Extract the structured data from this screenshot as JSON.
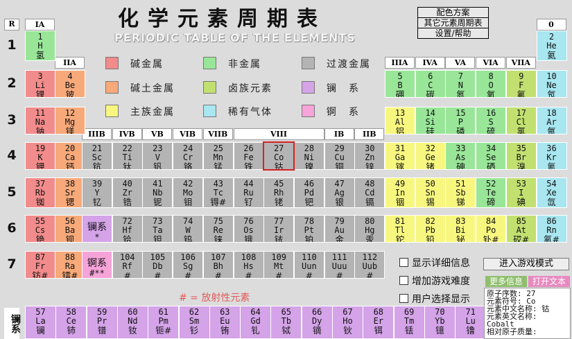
{
  "window": {
    "title": "化学元素周期表",
    "subtitle": "PERIODIC TABLE OF THE ELEMENTS"
  },
  "menu": [
    {
      "label": "配色方案"
    },
    {
      "label": "其它元素周期表"
    },
    {
      "label": "设置/帮助"
    }
  ],
  "period_header": "R",
  "periods": [
    "1",
    "2",
    "3",
    "4",
    "5",
    "6",
    "7"
  ],
  "groups": [
    {
      "label": "IA",
      "pos": "ia"
    },
    {
      "label": "IIA",
      "pos": "iia"
    },
    {
      "label": "IIIB",
      "pos": "3"
    },
    {
      "label": "IVB",
      "pos": "4"
    },
    {
      "label": "VB",
      "pos": "5"
    },
    {
      "label": "VIB",
      "pos": "6"
    },
    {
      "label": "VIIB",
      "pos": "7"
    },
    {
      "label": "VIII",
      "pos": "8"
    },
    {
      "label": "IB",
      "pos": "11"
    },
    {
      "label": "IIB",
      "pos": "12"
    },
    {
      "label": "IIIA",
      "pos": "13"
    },
    {
      "label": "IVA",
      "pos": "14"
    },
    {
      "label": "VA",
      "pos": "15"
    },
    {
      "label": "VIA",
      "pos": "16"
    },
    {
      "label": "VIIA",
      "pos": "17"
    },
    {
      "label": "0",
      "pos": "0"
    }
  ],
  "colors": {
    "alkali": "#f28b8b",
    "alkaline": "#f7a97a",
    "nonmetal": "#99e699",
    "halogen": "#c2e070",
    "transition": "#b4b4b4",
    "lanthanide": "#d4a3e8",
    "main_metal": "#f7f780",
    "noble": "#a8e6f0",
    "actinide": "#f5a3d8",
    "selected": "#d62020",
    "radioactive_note": "#e45a5a",
    "tab_more": "#8fbf6e",
    "tab_open": "#e889c0"
  },
  "legend": [
    {
      "label": "碱金属",
      "color": "alkali"
    },
    {
      "label": "碱土金属",
      "color": "alkaline"
    },
    {
      "label": "主族金属",
      "color": "main_metal"
    },
    {
      "label": "非金属",
      "color": "nonmetal"
    },
    {
      "label": "卤族元素",
      "color": "halogen"
    },
    {
      "label": "稀有气体",
      "color": "noble"
    },
    {
      "label": "过渡金属",
      "color": "transition"
    },
    {
      "label": "镧　系",
      "color": "lanthanide"
    },
    {
      "label": "锕　系",
      "color": "actinide"
    }
  ],
  "elements": [
    {
      "z": "1",
      "sym": "H",
      "name": "氢",
      "cat": "nonmetal",
      "col": 1,
      "row": 1
    },
    {
      "z": "2",
      "sym": "He",
      "name": "氦",
      "cat": "noble",
      "col": 18,
      "row": 1
    },
    {
      "z": "3",
      "sym": "Li",
      "name": "锂",
      "cat": "alkali",
      "col": 1,
      "row": 2
    },
    {
      "z": "4",
      "sym": "Be",
      "name": "铍",
      "cat": "alkaline",
      "col": 2,
      "row": 2
    },
    {
      "z": "5",
      "sym": "B",
      "name": "硼",
      "cat": "nonmetal",
      "col": 13,
      "row": 2
    },
    {
      "z": "6",
      "sym": "C",
      "name": "碳",
      "cat": "nonmetal",
      "col": 14,
      "row": 2
    },
    {
      "z": "7",
      "sym": "N",
      "name": "氮",
      "cat": "nonmetal",
      "col": 15,
      "row": 2
    },
    {
      "z": "8",
      "sym": "O",
      "name": "氧",
      "cat": "nonmetal",
      "col": 16,
      "row": 2
    },
    {
      "z": "9",
      "sym": "F",
      "name": "氟",
      "cat": "halogen",
      "col": 17,
      "row": 2
    },
    {
      "z": "10",
      "sym": "Ne",
      "name": "氖",
      "cat": "noble",
      "col": 18,
      "row": 2
    },
    {
      "z": "11",
      "sym": "Na",
      "name": "钠",
      "cat": "alkali",
      "col": 1,
      "row": 3
    },
    {
      "z": "12",
      "sym": "Mg",
      "name": "镁",
      "cat": "alkaline",
      "col": 2,
      "row": 3
    },
    {
      "z": "13",
      "sym": "Al",
      "name": "铝",
      "cat": "main_metal",
      "col": 13,
      "row": 3
    },
    {
      "z": "14",
      "sym": "Si",
      "name": "硅",
      "cat": "nonmetal",
      "col": 14,
      "row": 3
    },
    {
      "z": "15",
      "sym": "P",
      "name": "磷",
      "cat": "nonmetal",
      "col": 15,
      "row": 3
    },
    {
      "z": "16",
      "sym": "S",
      "name": "硫",
      "cat": "nonmetal",
      "col": 16,
      "row": 3
    },
    {
      "z": "17",
      "sym": "Cl",
      "name": "氯",
      "cat": "halogen",
      "col": 17,
      "row": 3
    },
    {
      "z": "18",
      "sym": "Ar",
      "name": "氩",
      "cat": "noble",
      "col": 18,
      "row": 3
    },
    {
      "z": "19",
      "sym": "K",
      "name": "钾",
      "cat": "alkali",
      "col": 1,
      "row": 4
    },
    {
      "z": "20",
      "sym": "Ca",
      "name": "钙",
      "cat": "alkaline",
      "col": 2,
      "row": 4
    },
    {
      "z": "21",
      "sym": "Sc",
      "name": "钪",
      "cat": "transition",
      "col": 3,
      "row": 4
    },
    {
      "z": "22",
      "sym": "Ti",
      "name": "钛",
      "cat": "transition",
      "col": 4,
      "row": 4
    },
    {
      "z": "23",
      "sym": "V",
      "name": "钒",
      "cat": "transition",
      "col": 5,
      "row": 4
    },
    {
      "z": "24",
      "sym": "Cr",
      "name": "铬",
      "cat": "transition",
      "col": 6,
      "row": 4
    },
    {
      "z": "25",
      "sym": "Mn",
      "name": "锰",
      "cat": "transition",
      "col": 7,
      "row": 4
    },
    {
      "z": "26",
      "sym": "Fe",
      "name": "铁",
      "cat": "transition",
      "col": 8,
      "row": 4
    },
    {
      "z": "27",
      "sym": "Co",
      "name": "钴",
      "cat": "transition",
      "col": 9,
      "row": 4,
      "selected": true
    },
    {
      "z": "28",
      "sym": "Ni",
      "name": "镍",
      "cat": "transition",
      "col": 10,
      "row": 4
    },
    {
      "z": "29",
      "sym": "Cu",
      "name": "铜",
      "cat": "transition",
      "col": 11,
      "row": 4
    },
    {
      "z": "30",
      "sym": "Zn",
      "name": "锌",
      "cat": "transition",
      "col": 12,
      "row": 4
    },
    {
      "z": "31",
      "sym": "Ga",
      "name": "镓",
      "cat": "main_metal",
      "col": 13,
      "row": 4
    },
    {
      "z": "32",
      "sym": "Ge",
      "name": "锗",
      "cat": "main_metal",
      "col": 14,
      "row": 4
    },
    {
      "z": "33",
      "sym": "As",
      "name": "砷",
      "cat": "nonmetal",
      "col": 15,
      "row": 4
    },
    {
      "z": "34",
      "sym": "Se",
      "name": "硒",
      "cat": "nonmetal",
      "col": 16,
      "row": 4
    },
    {
      "z": "35",
      "sym": "Br",
      "name": "溴",
      "cat": "halogen",
      "col": 17,
      "row": 4
    },
    {
      "z": "36",
      "sym": "Kr",
      "name": "氪",
      "cat": "noble",
      "col": 18,
      "row": 4
    },
    {
      "z": "37",
      "sym": "Rb",
      "name": "铷",
      "cat": "alkali",
      "col": 1,
      "row": 5
    },
    {
      "z": "38",
      "sym": "Sr",
      "name": "锶",
      "cat": "alkaline",
      "col": 2,
      "row": 5
    },
    {
      "z": "39",
      "sym": "Y",
      "name": "钇",
      "cat": "transition",
      "col": 3,
      "row": 5
    },
    {
      "z": "40",
      "sym": "Zr",
      "name": "锆",
      "cat": "transition",
      "col": 4,
      "row": 5
    },
    {
      "z": "41",
      "sym": "Nb",
      "name": "铌",
      "cat": "transition",
      "col": 5,
      "row": 5
    },
    {
      "z": "42",
      "sym": "Mo",
      "name": "钼",
      "cat": "transition",
      "col": 6,
      "row": 5
    },
    {
      "z": "43",
      "sym": "Tc",
      "name": "锝#",
      "cat": "transition",
      "col": 7,
      "row": 5
    },
    {
      "z": "44",
      "sym": "Ru",
      "name": "钌",
      "cat": "transition",
      "col": 8,
      "row": 5
    },
    {
      "z": "45",
      "sym": "Rh",
      "name": "铑",
      "cat": "transition",
      "col": 9,
      "row": 5
    },
    {
      "z": "46",
      "sym": "Pd",
      "name": "钯",
      "cat": "transition",
      "col": 10,
      "row": 5
    },
    {
      "z": "47",
      "sym": "Ag",
      "name": "银",
      "cat": "transition",
      "col": 11,
      "row": 5
    },
    {
      "z": "48",
      "sym": "Cd",
      "name": "镉",
      "cat": "transition",
      "col": 12,
      "row": 5
    },
    {
      "z": "49",
      "sym": "In",
      "name": "铟",
      "cat": "main_metal",
      "col": 13,
      "row": 5
    },
    {
      "z": "50",
      "sym": "Sn",
      "name": "锡",
      "cat": "main_metal",
      "col": 14,
      "row": 5
    },
    {
      "z": "51",
      "sym": "Sb",
      "name": "锑",
      "cat": "main_metal",
      "col": 15,
      "row": 5
    },
    {
      "z": "52",
      "sym": "Te",
      "name": "碲",
      "cat": "nonmetal",
      "col": 16,
      "row": 5
    },
    {
      "z": "53",
      "sym": "I",
      "name": "碘",
      "cat": "halogen",
      "col": 17,
      "row": 5
    },
    {
      "z": "54",
      "sym": "Xe",
      "name": "氙",
      "cat": "noble",
      "col": 18,
      "row": 5
    },
    {
      "z": "55",
      "sym": "Cs",
      "name": "铯",
      "cat": "alkali",
      "col": 1,
      "row": 6
    },
    {
      "z": "56",
      "sym": "Ba",
      "name": "钡",
      "cat": "alkaline",
      "col": 2,
      "row": 6
    },
    {
      "z": "",
      "sym": "镧系",
      "name": "*",
      "cat": "lanthanide",
      "col": 3,
      "row": 6
    },
    {
      "z": "72",
      "sym": "Hf",
      "name": "铪",
      "cat": "transition",
      "col": 4,
      "row": 6
    },
    {
      "z": "73",
      "sym": "Ta",
      "name": "钽",
      "cat": "transition",
      "col": 5,
      "row": 6
    },
    {
      "z": "74",
      "sym": "W",
      "name": "钨",
      "cat": "transition",
      "col": 6,
      "row": 6
    },
    {
      "z": "75",
      "sym": "Re",
      "name": "铼",
      "cat": "transition",
      "col": 7,
      "row": 6
    },
    {
      "z": "76",
      "sym": "Os",
      "name": "锇",
      "cat": "transition",
      "col": 8,
      "row": 6
    },
    {
      "z": "77",
      "sym": "Ir",
      "name": "铱",
      "cat": "transition",
      "col": 9,
      "row": 6
    },
    {
      "z": "78",
      "sym": "Pt",
      "name": "铂",
      "cat": "transition",
      "col": 10,
      "row": 6
    },
    {
      "z": "79",
      "sym": "Au",
      "name": "金",
      "cat": "transition",
      "col": 11,
      "row": 6
    },
    {
      "z": "80",
      "sym": "Hg",
      "name": "汞",
      "cat": "transition",
      "col": 12,
      "row": 6
    },
    {
      "z": "81",
      "sym": "Tl",
      "name": "铊",
      "cat": "main_metal",
      "col": 13,
      "row": 6
    },
    {
      "z": "82",
      "sym": "Pb",
      "name": "铅",
      "cat": "main_metal",
      "col": 14,
      "row": 6
    },
    {
      "z": "83",
      "sym": "Bi",
      "name": "铋",
      "cat": "main_metal",
      "col": 15,
      "row": 6
    },
    {
      "z": "84",
      "sym": "Po",
      "name": "钋#",
      "cat": "main_metal",
      "col": 16,
      "row": 6
    },
    {
      "z": "85",
      "sym": "At",
      "name": "砹#",
      "cat": "halogen",
      "col": 17,
      "row": 6
    },
    {
      "z": "86",
      "sym": "Rn",
      "name": "氡#",
      "cat": "noble",
      "col": 18,
      "row": 6
    },
    {
      "z": "87",
      "sym": "Fr",
      "name": "钫#",
      "cat": "alkali",
      "col": 1,
      "row": 7
    },
    {
      "z": "88",
      "sym": "Ra",
      "name": "镭#",
      "cat": "alkaline",
      "col": 2,
      "row": 7
    },
    {
      "z": "",
      "sym": "锕系",
      "name": "#**",
      "cat": "actinide",
      "col": 3,
      "row": 7
    },
    {
      "z": "104",
      "sym": "Rf",
      "name": "#",
      "cat": "transition",
      "col": 4,
      "row": 7
    },
    {
      "z": "105",
      "sym": "Db",
      "name": "#",
      "cat": "transition",
      "col": 5,
      "row": 7
    },
    {
      "z": "106",
      "sym": "Sg",
      "name": "#",
      "cat": "transition",
      "col": 6,
      "row": 7
    },
    {
      "z": "107",
      "sym": "Bh",
      "name": "#",
      "cat": "transition",
      "col": 7,
      "row": 7
    },
    {
      "z": "108",
      "sym": "Hs",
      "name": "#",
      "cat": "transition",
      "col": 8,
      "row": 7
    },
    {
      "z": "109",
      "sym": "Mt",
      "name": "#",
      "cat": "transition",
      "col": 9,
      "row": 7
    },
    {
      "z": "110",
      "sym": "Uun",
      "name": "#",
      "cat": "transition",
      "col": 10,
      "row": 7
    },
    {
      "z": "111",
      "sym": "Uuu",
      "name": "#",
      "cat": "transition",
      "col": 11,
      "row": 7
    },
    {
      "z": "112",
      "sym": "Uub",
      "name": "#",
      "cat": "transition",
      "col": 12,
      "row": 7
    }
  ],
  "lanthanides": {
    "label": "镧系",
    "items": [
      {
        "z": "57",
        "sym": "La",
        "name": "镧"
      },
      {
        "z": "58",
        "sym": "Ce",
        "name": "铈"
      },
      {
        "z": "59",
        "sym": "Pr",
        "name": "镨"
      },
      {
        "z": "60",
        "sym": "Nd",
        "name": "钕"
      },
      {
        "z": "61",
        "sym": "Pm",
        "name": "钷#"
      },
      {
        "z": "62",
        "sym": "Sm",
        "name": "钐"
      },
      {
        "z": "63",
        "sym": "Eu",
        "name": "铕"
      },
      {
        "z": "64",
        "sym": "Gd",
        "name": "钆"
      },
      {
        "z": "65",
        "sym": "Tb",
        "name": "铽"
      },
      {
        "z": "66",
        "sym": "Dy",
        "name": "镝"
      },
      {
        "z": "67",
        "sym": "Ho",
        "name": "钬"
      },
      {
        "z": "68",
        "sym": "Er",
        "name": "铒"
      },
      {
        "z": "69",
        "sym": "Tm",
        "name": "铥"
      },
      {
        "z": "70",
        "sym": "Yb",
        "name": "镱"
      },
      {
        "z": "71",
        "sym": "Lu",
        "name": "镥"
      }
    ]
  },
  "radioactive_note": "# = 放射性元素",
  "options": [
    {
      "label": "显示详细信息",
      "checked": false
    },
    {
      "label": "增加游戏难度",
      "checked": false
    },
    {
      "label": "用户选择显示",
      "checked": false
    }
  ],
  "buttons": {
    "play": "进入游戏模式"
  },
  "info_panel": {
    "tab_more": "更多信息",
    "tab_open": "打开文本",
    "lines": [
      "原子序数: 27",
      "元素符号: Co",
      "元素中文名称: 钴",
      "元素英文名称:",
      "Cobalt",
      "相对原子质量:"
    ]
  }
}
